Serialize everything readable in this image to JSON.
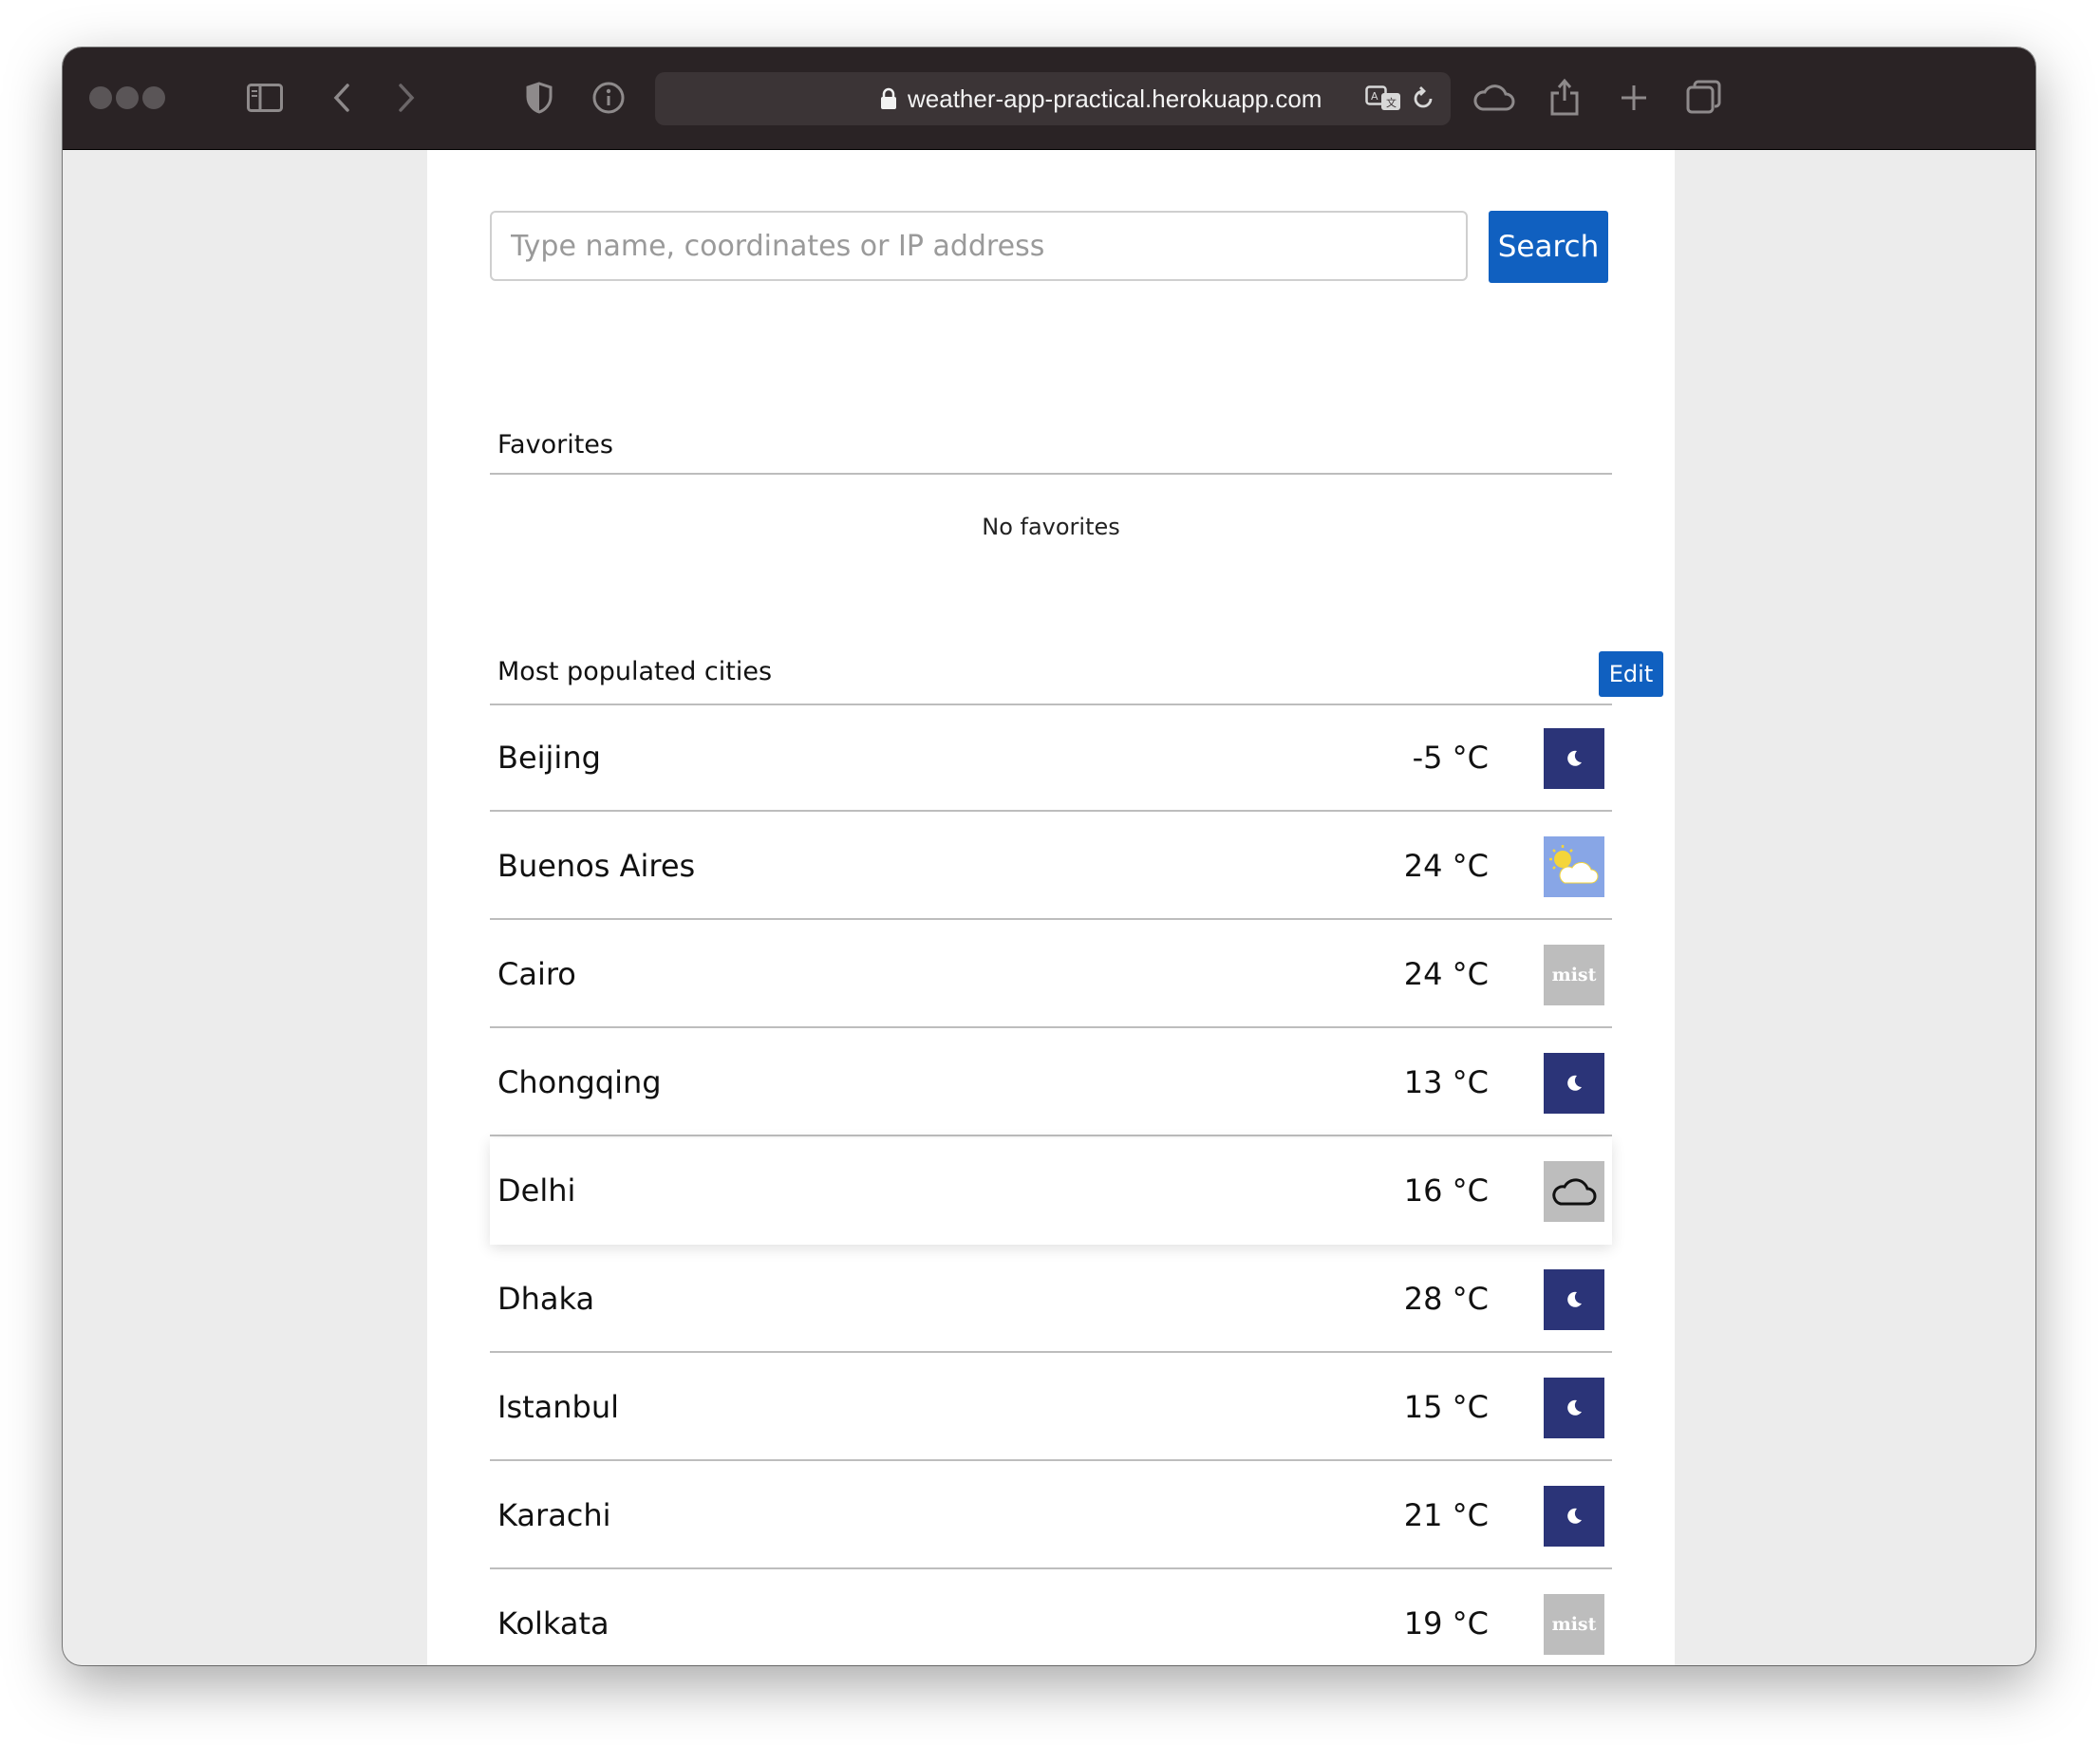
{
  "browser": {
    "url": "weather-app-practical.herokuapp.com"
  },
  "search": {
    "placeholder": "Type name, coordinates or IP address",
    "value": "",
    "button_label": "Search",
    "button_color": "#1060c0"
  },
  "favorites": {
    "title": "Favorites",
    "empty_text": "No favorites"
  },
  "cities": {
    "title": "Most populated cities",
    "edit_label": "Edit",
    "items": [
      {
        "name": "Beijing",
        "temp": "-5 °C",
        "icon": "moon-icon"
      },
      {
        "name": "Buenos Aires",
        "temp": "24 °C",
        "icon": "partly-cloudy-sun-icon"
      },
      {
        "name": "Cairo",
        "temp": "24 °C",
        "icon": "mist-icon",
        "icon_text": "mist"
      },
      {
        "name": "Chongqing",
        "temp": "13 °C",
        "icon": "moon-icon"
      },
      {
        "name": "Delhi",
        "temp": "16 °C",
        "icon": "cloud-icon"
      },
      {
        "name": "Dhaka",
        "temp": "28 °C",
        "icon": "moon-icon"
      },
      {
        "name": "Istanbul",
        "temp": "15 °C",
        "icon": "moon-icon"
      },
      {
        "name": "Karachi",
        "temp": "21 °C",
        "icon": "moon-icon"
      },
      {
        "name": "Kolkata",
        "temp": "19 °C",
        "icon": "mist-icon",
        "icon_text": "mist"
      }
    ]
  }
}
